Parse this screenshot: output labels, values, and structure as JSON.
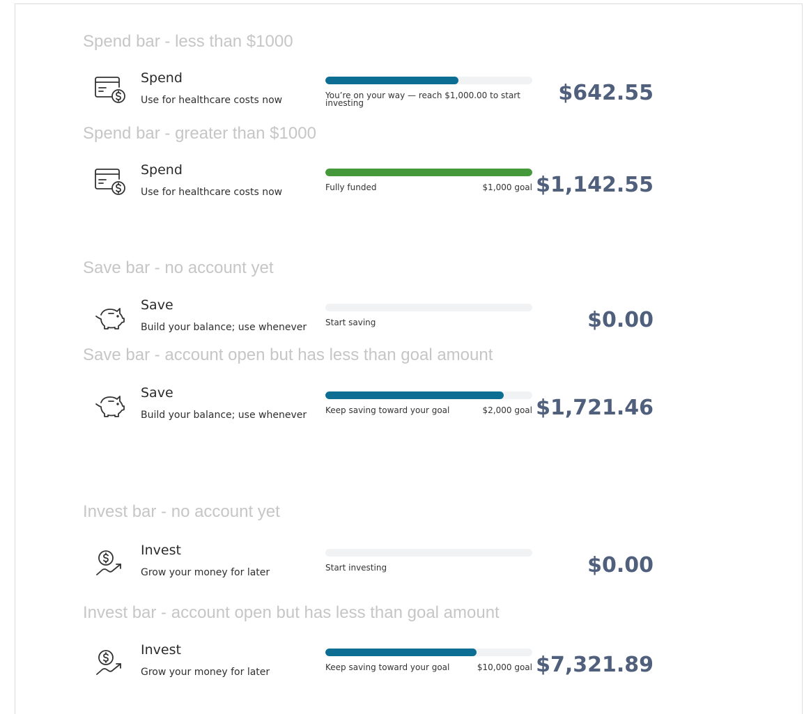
{
  "colors": {
    "label_gray": "#c6c6c6",
    "track": "#f1f2f4",
    "fill_blue": "#0d6e94",
    "fill_green": "#46993a",
    "amount": "#50607c"
  },
  "sections": [
    {
      "label": "Spend bar - less than $1000",
      "icon": "card-dollar-icon",
      "title": "Spend",
      "subtitle": "Use for healthcare costs now",
      "progress": 0.6425,
      "fill_color": "#0d6e94",
      "message": "You’re on your way — reach $1,000.00 to start investing",
      "goal": "",
      "amount": "$642.55"
    },
    {
      "label": "Spend bar - greater than $1000",
      "icon": "card-dollar-icon",
      "title": "Spend",
      "subtitle": "Use for healthcare costs now",
      "progress": 1.0,
      "fill_color": "#46993a",
      "message": "Fully funded",
      "goal": "$1,000 goal",
      "amount": "$1,142.55"
    },
    {
      "label": "Save bar - no account yet",
      "icon": "piggy-bank-icon",
      "title": "Save",
      "subtitle": "Build your balance; use whenever",
      "progress": 0,
      "fill_color": "#0d6e94",
      "message": "Start saving",
      "goal": "",
      "amount": "$0.00"
    },
    {
      "label": "Save bar - account open but has less than goal amount",
      "icon": "piggy-bank-icon",
      "title": "Save",
      "subtitle": "Build your balance; use whenever",
      "progress": 0.8607,
      "fill_color": "#0d6e94",
      "message": "Keep saving toward your goal",
      "goal": "$2,000 goal",
      "amount": "$1,721.46"
    },
    {
      "label": "Invest bar - no account yet",
      "icon": "dollar-growth-icon",
      "title": "Invest",
      "subtitle": "Grow your money for later",
      "progress": 0,
      "fill_color": "#0d6e94",
      "message": "Start investing",
      "goal": "",
      "amount": "$0.00"
    },
    {
      "label": "Invest bar - account open but has less than goal amount",
      "icon": "dollar-growth-icon",
      "title": "Invest",
      "subtitle": "Grow your money for later",
      "progress": 0.732,
      "fill_color": "#0d6e94",
      "message": "Keep saving toward your goal",
      "goal": "$10,000 goal",
      "amount": "$7,321.89"
    }
  ]
}
